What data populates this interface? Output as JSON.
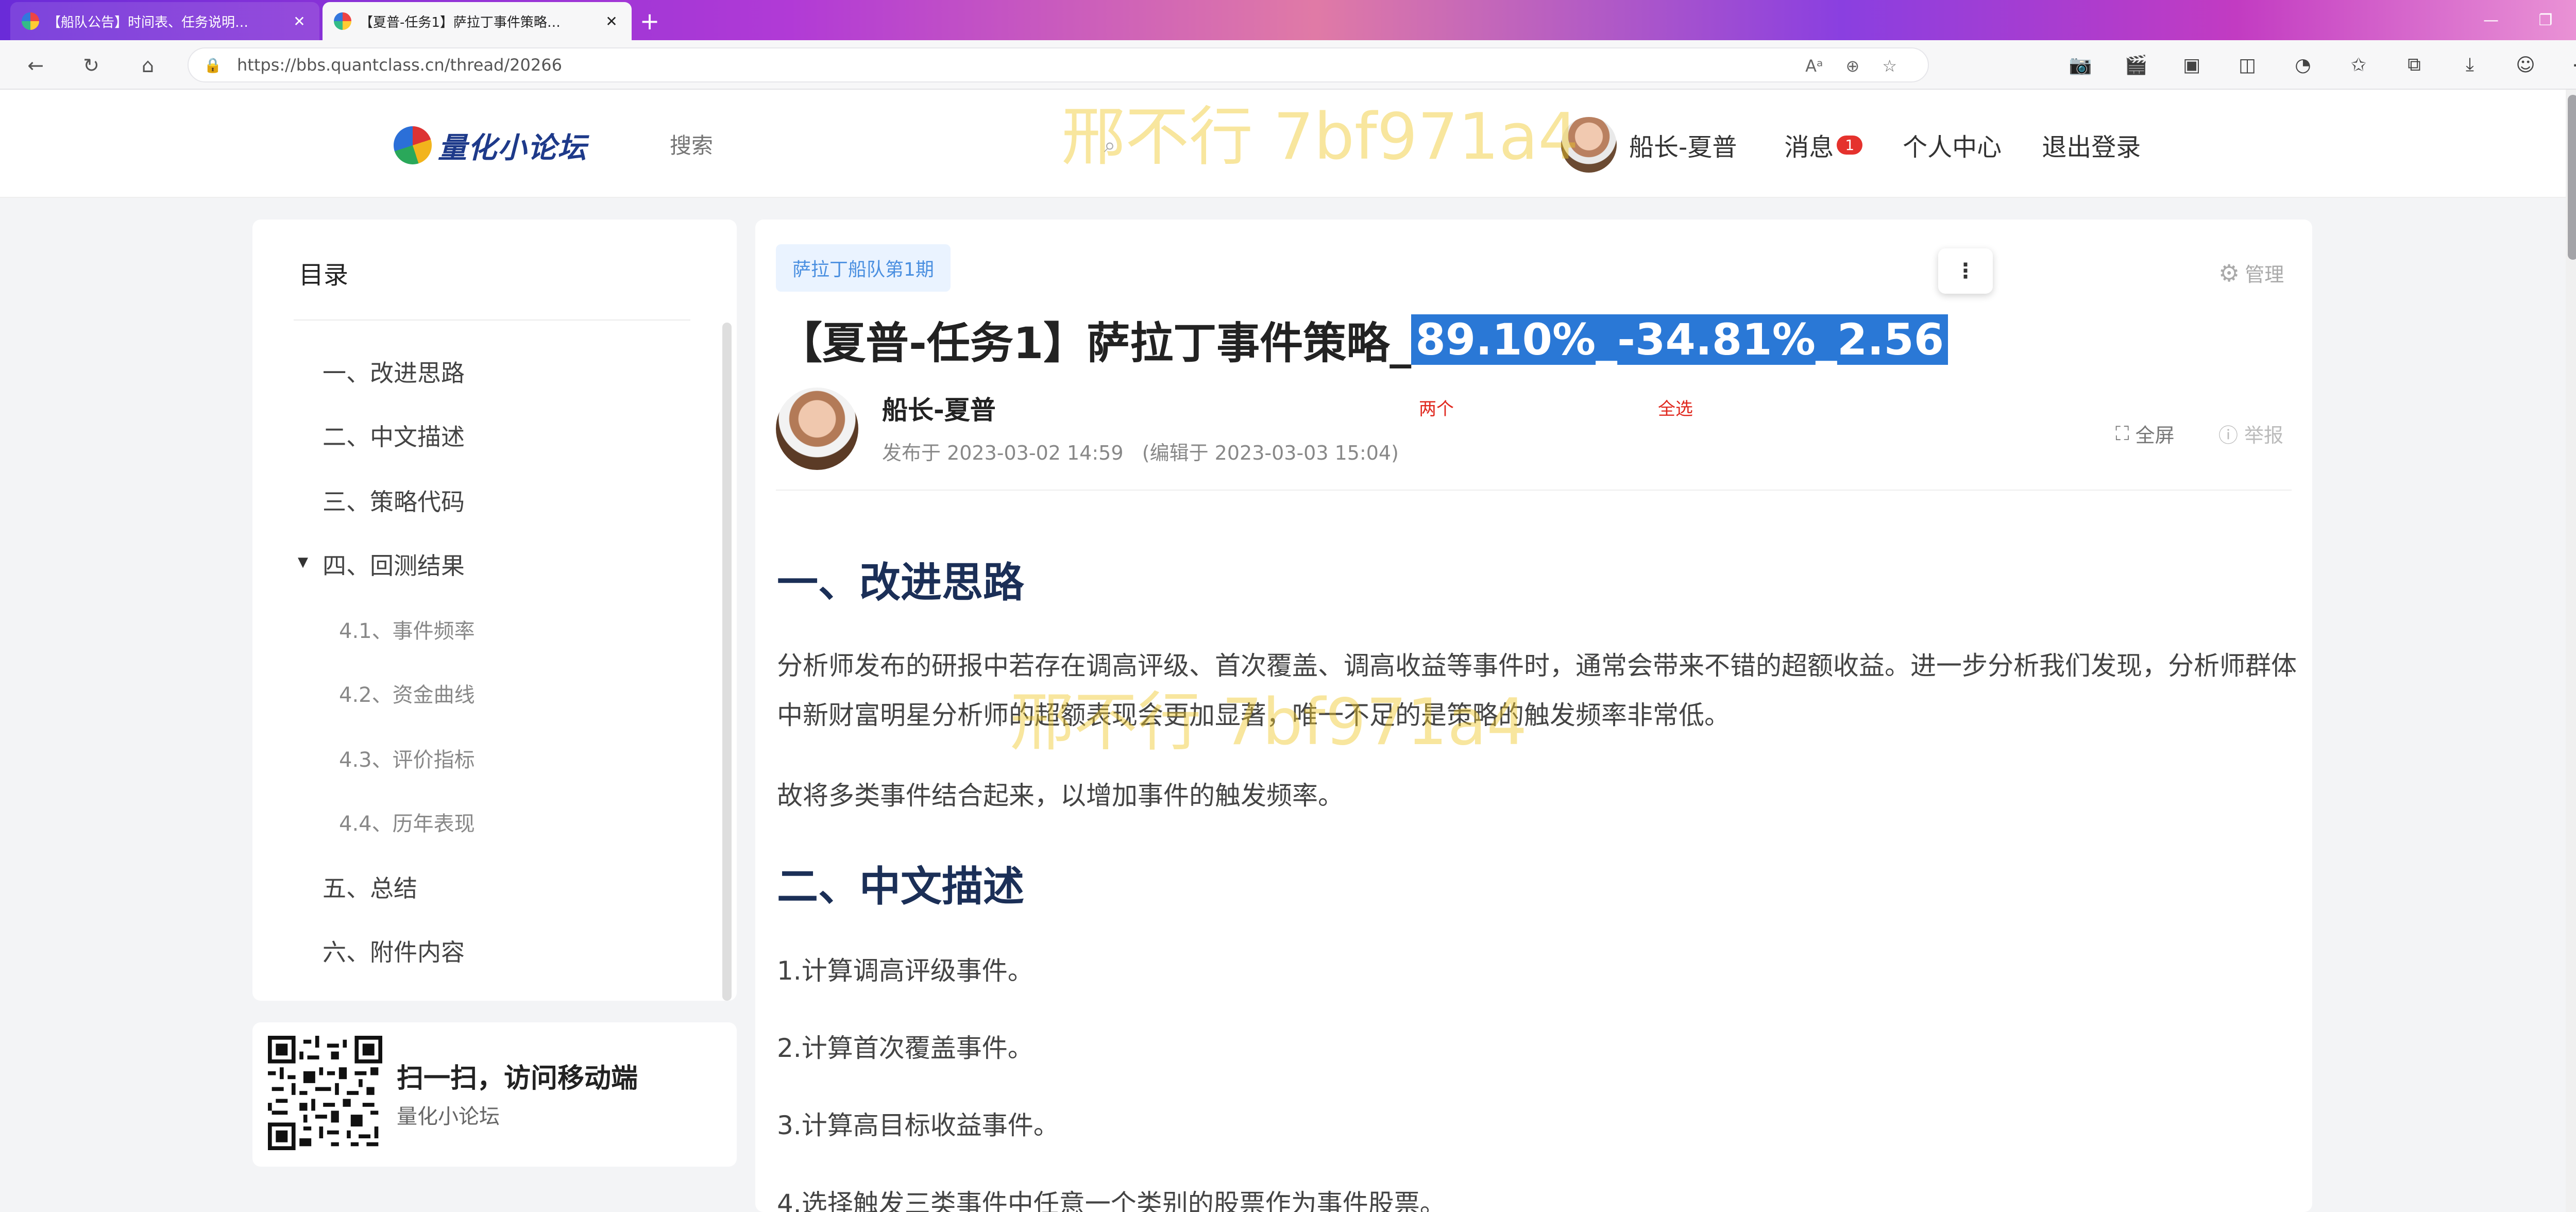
{
  "browser": {
    "tabs": [
      {
        "title": "【船队公告】时间表、任务说明…",
        "active": false
      },
      {
        "title": "【夏普-任务1】萨拉丁事件策略…",
        "active": true
      }
    ],
    "url": "https://bbs.quantclass.cn/thread/20266"
  },
  "header": {
    "logo_text": "量化小论坛",
    "search_placeholder": "搜索",
    "username": "船长-夏普",
    "messages_label": "消息",
    "messages_count": "1",
    "profile_label": "个人中心",
    "logout_label": "退出登录"
  },
  "toc": {
    "title": "目录",
    "items": [
      {
        "label": "一、改进思路",
        "level": 1
      },
      {
        "label": "二、中文描述",
        "level": 1
      },
      {
        "label": "三、策略代码",
        "level": 1
      },
      {
        "label": "四、回测结果",
        "level": 1
      },
      {
        "label": "4.1、事件频率",
        "level": 2
      },
      {
        "label": "4.2、资金曲线",
        "level": 2
      },
      {
        "label": "4.3、评价指标",
        "level": 2
      },
      {
        "label": "4.4、历年表现",
        "level": 2
      },
      {
        "label": "五、总结",
        "level": 1
      },
      {
        "label": "六、附件内容",
        "level": 1
      }
    ]
  },
  "qr": {
    "title": "扫一扫，访问移动端",
    "subtitle": "量化小论坛"
  },
  "article": {
    "tag": "萨拉丁船队第1期",
    "manage_label": "管理",
    "title_prefix": "【夏普-任务1】萨拉丁事件策略_",
    "title_selected": "89.10%_-34.81%_2.56",
    "author": "船长-夏普",
    "published": "发布于 2023-03-02 14:59",
    "edited": "(编辑于 2023-03-03 15:04)",
    "annotation_1": "两个",
    "annotation_2": "全选",
    "fullscreen_label": "全屏",
    "report_label": "举报",
    "sections": [
      {
        "heading": "一、改进思路"
      },
      {
        "heading": "二、中文描述"
      }
    ],
    "para_1": "分析师发布的研报中若存在调高评级、首次覆盖、调高收益等事件时，通常会带来不错的超额收益。进一步分析我们发现，分析师群体中新财富明星分析师的超额表现会更加显著，唯一不足的是策略的触发频率非常低。",
    "para_2": "故将多类事件结合起来，以增加事件的触发频率。",
    "list": [
      "1.计算调高评级事件。",
      "2.计算首次覆盖事件。",
      "3.计算高目标收益事件。",
      "4.选择触发三类事件中任意一个类别的股票作为事件股票。"
    ]
  },
  "watermark": "邢不行 7bf971a4"
}
